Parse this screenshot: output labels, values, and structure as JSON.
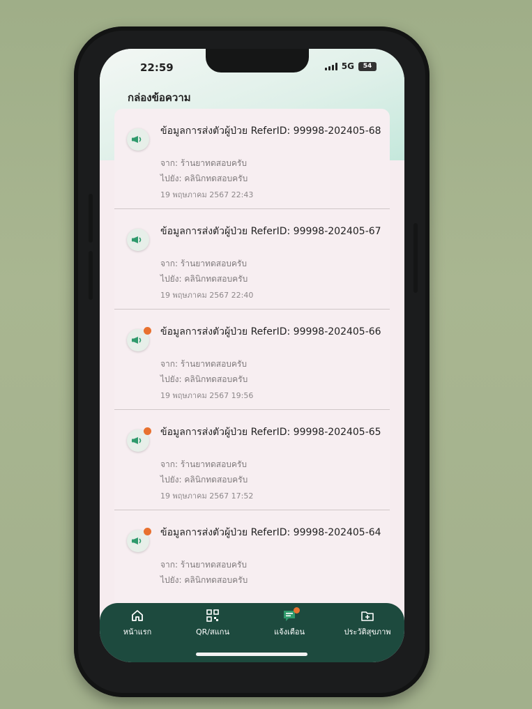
{
  "status_bar": {
    "time": "22:59",
    "network": "5G",
    "battery": "54"
  },
  "header": {
    "title": "กล่องข้อความ"
  },
  "messages": [
    {
      "title": "ข้อมูลการส่งตัวผู้ป่วย ReferID: 99998-202405-68",
      "from": "จาก: ร้านยาทดสอบครับ",
      "to": "ไปยัง: คลินิกทดสอบครับ",
      "date": "19 พฤษภาคม 2567 22:43",
      "unread": false
    },
    {
      "title": "ข้อมูลการส่งตัวผู้ป่วย ReferID: 99998-202405-67",
      "from": "จาก: ร้านยาทดสอบครับ",
      "to": "ไปยัง: คลินิกทดสอบครับ",
      "date": "19 พฤษภาคม 2567 22:40",
      "unread": false
    },
    {
      "title": "ข้อมูลการส่งตัวผู้ป่วย ReferID: 99998-202405-66",
      "from": "จาก: ร้านยาทดสอบครับ",
      "to": "ไปยัง: คลินิกทดสอบครับ",
      "date": "19 พฤษภาคม 2567 19:56",
      "unread": true
    },
    {
      "title": "ข้อมูลการส่งตัวผู้ป่วย ReferID: 99998-202405-65",
      "from": "จาก: ร้านยาทดสอบครับ",
      "to": "ไปยัง: คลินิกทดสอบครับ",
      "date": "19 พฤษภาคม 2567 17:52",
      "unread": true
    },
    {
      "title": "ข้อมูลการส่งตัวผู้ป่วย ReferID: 99998-202405-64",
      "from": "จาก: ร้านยาทดสอบครับ",
      "to": "ไปยัง: คลินิกทดสอบครับ",
      "date": "",
      "unread": true
    }
  ],
  "nav": {
    "home": "หน้าแรก",
    "qr": "QR/สแกน",
    "alerts": "แจ้งเตือน",
    "history": "ประวัติสุขภาพ"
  },
  "colors": {
    "nav_bg": "#1d4a3e",
    "accent": "#2f9a6c",
    "unread": "#e8712f"
  },
  "icons": {
    "message": "megaphone-icon",
    "home": "home-icon",
    "qr": "qr-code-icon",
    "alerts": "chat-bubble-icon",
    "history": "folder-plus-icon"
  }
}
